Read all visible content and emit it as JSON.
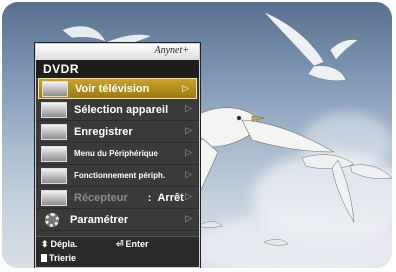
{
  "colors": {
    "highlight": "#c9a227",
    "menu_bg": "#3a3a3a",
    "text": "#ffffff",
    "disabled_text": "#8a8a8a"
  },
  "brand": {
    "logo_text": "Anynet+"
  },
  "menu": {
    "title": "DVDR",
    "items": [
      {
        "label": "Voir télévision",
        "icon": "tv-icon",
        "active": true
      },
      {
        "label": "Sélection appareil",
        "icon": "device-select-icon"
      },
      {
        "label": "Enregistrer",
        "icon": "record-icon"
      },
      {
        "label": "Menu du Périphérique",
        "icon": "device-menu-icon"
      },
      {
        "label": "Fonctionnement périph.",
        "icon": "device-operation-icon"
      },
      {
        "label": "Récepteur",
        "value": "Arrêt",
        "colon": ":",
        "icon": "receiver-icon",
        "disabled": true
      },
      {
        "label": "Paramétrer",
        "icon": "gear-icon"
      }
    ],
    "arrow_glyph": "▷"
  },
  "footer": {
    "move": "Dépla.",
    "enter": "Enter",
    "sort": "Trierie"
  }
}
